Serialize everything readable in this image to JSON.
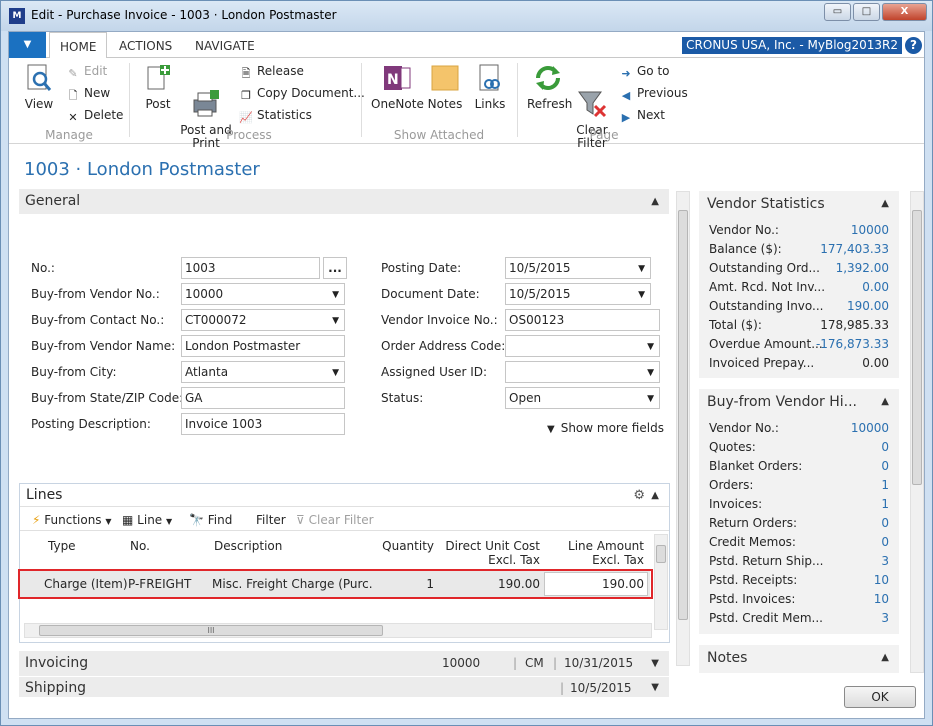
{
  "window": {
    "title": "Edit - Purchase Invoice - 1003 · London Postmaster",
    "minimize": "▭",
    "maximize": "□",
    "close": "X"
  },
  "ribbon_tabs": [
    "HOME",
    "ACTIONS",
    "NAVIGATE"
  ],
  "company_label": "CRONUS USA, Inc. - MyBlog2013R2",
  "help_label": "?",
  "ribbon": {
    "manage": {
      "label": "Manage",
      "view": "View",
      "edit": "Edit",
      "new": "New",
      "delete": "Delete"
    },
    "process": {
      "label": "Process",
      "post": "Post",
      "post_print": "Post and\nPrint",
      "release": "Release",
      "copy_document": "Copy Document...",
      "statistics": "Statistics"
    },
    "show_attached": {
      "label": "Show Attached",
      "onenote": "OneNote",
      "notes": "Notes",
      "links": "Links"
    },
    "page": {
      "label": "Page",
      "refresh": "Refresh",
      "clear_filter": "Clear\nFilter",
      "goto": "Go to",
      "previous": "Previous",
      "next": "Next"
    }
  },
  "page_title": "1003 · London Postmaster",
  "general": {
    "title": "General",
    "left": [
      {
        "label": "No.:",
        "value": "1003",
        "type": "assist"
      },
      {
        "label": "Buy-from Vendor No.:",
        "value": "10000",
        "type": "dropdown"
      },
      {
        "label": "Buy-from Contact No.:",
        "value": "CT000072",
        "type": "dropdown"
      },
      {
        "label": "Buy-from Vendor Name:",
        "value": "London Postmaster",
        "type": "text"
      },
      {
        "label": "Buy-from City:",
        "value": "Atlanta",
        "type": "dropdown"
      },
      {
        "label": "Buy-from State/ZIP Code:",
        "value": "GA",
        "type": "text"
      },
      {
        "label": "Posting Description:",
        "value": "Invoice 1003",
        "type": "text"
      }
    ],
    "right": [
      {
        "label": "Posting Date:",
        "value": "10/5/2015",
        "type": "dropdown"
      },
      {
        "label": "Document Date:",
        "value": "10/5/2015",
        "type": "dropdown"
      },
      {
        "label": "Vendor Invoice No.:",
        "value": "OS00123",
        "type": "text"
      },
      {
        "label": "Order Address Code:",
        "value": "",
        "type": "dropdown"
      },
      {
        "label": "Assigned User ID:",
        "value": "",
        "type": "dropdown"
      },
      {
        "label": "Status:",
        "value": "Open",
        "type": "dropdown"
      }
    ],
    "show_more": "Show more fields"
  },
  "lines": {
    "title": "Lines",
    "toolbar": {
      "functions": "Functions",
      "line": "Line",
      "find": "Find",
      "filter": "Filter",
      "clear_filter": "Clear Filter"
    },
    "columns": [
      "Type",
      "No.",
      "Description",
      "Quantity",
      "Direct Unit Cost\nExcl. Tax",
      "Line Amount\nExcl. Tax"
    ],
    "rows": [
      {
        "type": "Charge (Item)",
        "no": "P-FREIGHT",
        "description": "Misc. Freight Charge (Purc...",
        "quantity": "1",
        "unit_cost": "190.00",
        "line_amount": "190.00"
      }
    ],
    "hscroll_grip": "III"
  },
  "invoicing": {
    "title": "Invoicing",
    "summary1": "10000",
    "summary2": "CM",
    "summary3": "10/31/2015"
  },
  "shipping": {
    "title": "Shipping",
    "summary1": "10/5/2015"
  },
  "vendor_statistics": {
    "title": "Vendor Statistics",
    "rows": [
      {
        "label": "Vendor No.:",
        "value": "10000",
        "link": true
      },
      {
        "label": "Balance ($):",
        "value": "177,403.33",
        "link": true
      },
      {
        "label": "Outstanding Ord...",
        "value": "1,392.00",
        "link": true
      },
      {
        "label": "Amt. Rcd. Not Inv...",
        "value": "0.00",
        "link": true
      },
      {
        "label": "Outstanding Invo...",
        "value": "190.00",
        "link": true
      },
      {
        "label": "Total ($):",
        "value": "178,985.33",
        "link": false
      },
      {
        "label": "Overdue Amount...",
        "value": "-176,873.33",
        "link": true
      },
      {
        "label": "Invoiced Prepay...",
        "value": "0.00",
        "link": false
      }
    ]
  },
  "vendor_history": {
    "title": "Buy-from Vendor Hi...",
    "rows": [
      {
        "label": "Vendor No.:",
        "value": "10000"
      },
      {
        "label": "Quotes:",
        "value": "0"
      },
      {
        "label": "Blanket Orders:",
        "value": "0"
      },
      {
        "label": "Orders:",
        "value": "1"
      },
      {
        "label": "Invoices:",
        "value": "1"
      },
      {
        "label": "Return Orders:",
        "value": "0"
      },
      {
        "label": "Credit Memos:",
        "value": "0"
      },
      {
        "label": "Pstd. Return Ship...",
        "value": "3"
      },
      {
        "label": "Pstd. Receipts:",
        "value": "10"
      },
      {
        "label": "Pstd. Invoices:",
        "value": "10"
      },
      {
        "label": "Pstd. Credit Mem...",
        "value": "3"
      }
    ]
  },
  "notes": {
    "title": "Notes"
  },
  "ok_label": "OK",
  "colors": {
    "accent": "#1b71c1",
    "link": "#2b70b0",
    "highlight": "#e0262a"
  }
}
